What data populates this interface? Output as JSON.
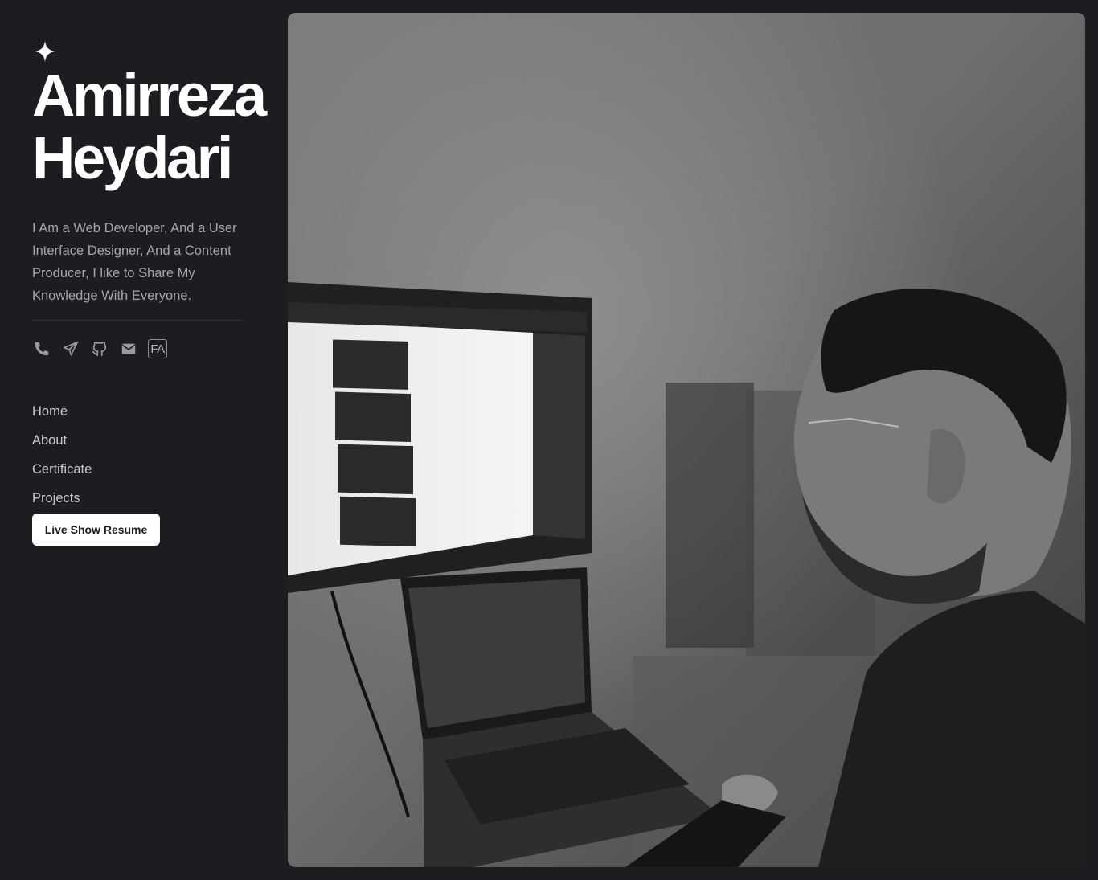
{
  "profile": {
    "first_name": "Amirreza",
    "last_name": "Heydari",
    "bio": "I Am a Web Developer, And a User Interface Designer, And a Content Producer, I like to Share My Knowledge With Everyone."
  },
  "socials": [
    {
      "icon": "phone-icon"
    },
    {
      "icon": "telegram-icon"
    },
    {
      "icon": "github-icon"
    },
    {
      "icon": "mail-icon"
    },
    {
      "icon": "language-toggle",
      "label": "FA"
    }
  ],
  "nav": {
    "items": [
      {
        "label": "Home"
      },
      {
        "label": "About"
      },
      {
        "label": "Certificate"
      },
      {
        "label": "Projects"
      }
    ]
  },
  "resume_button": {
    "label": "Live Show Resume"
  },
  "colors": {
    "background": "#1c1c21",
    "text_primary": "#ffffff",
    "text_muted": "#a6a6ad",
    "button_bg": "#ffffff"
  }
}
